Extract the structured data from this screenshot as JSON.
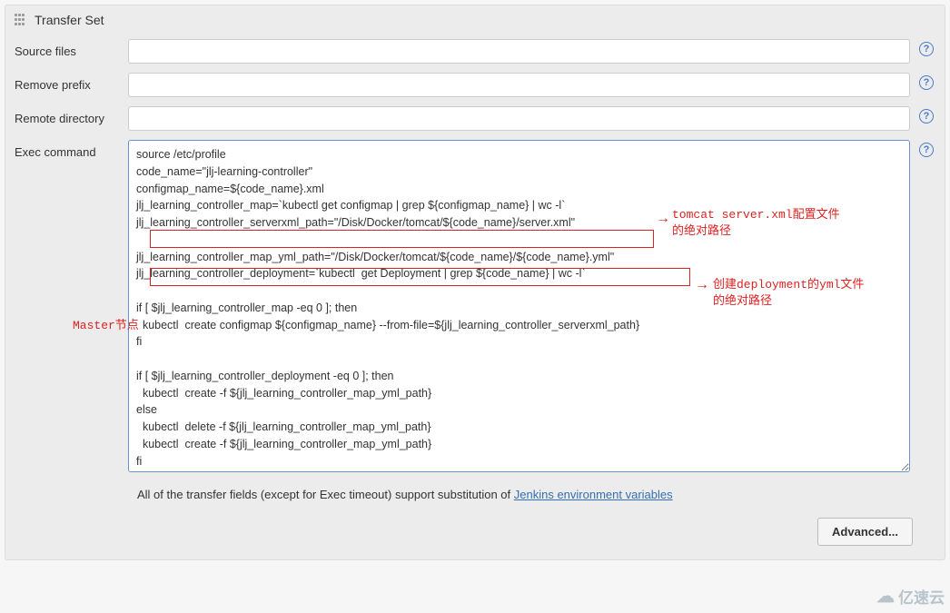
{
  "panelTitle": "Transfer Set",
  "labels": {
    "sourceFiles": "Source files",
    "removePrefix": "Remove prefix",
    "remoteDirectory": "Remote directory",
    "execCommand": "Exec command"
  },
  "values": {
    "sourceFiles": "",
    "removePrefix": "",
    "remoteDirectory": "",
    "execCommand": "source /etc/profile\ncode_name=\"jlj-learning-controller\"\nconfigmap_name=${code_name}.xml\njlj_learning_controller_map=`kubectl get configmap | grep ${configmap_name} | wc -l`\njlj_learning_controller_serverxml_path=\"/Disk/Docker/tomcat/${code_name}/server.xml\"\n\njlj_learning_controller_map_yml_path=\"/Disk/Docker/tomcat/${code_name}/${code_name}.yml\"\njlj_learning_controller_deployment=`kubectl  get Deployment | grep ${code_name} | wc -l`\n\nif [ $jlj_learning_controller_map -eq 0 ]; then\n  kubectl  create configmap ${configmap_name} --from-file=${jlj_learning_controller_serverxml_path}\nfi\n\nif [ $jlj_learning_controller_deployment -eq 0 ]; then\n  kubectl  create -f ${jlj_learning_controller_map_yml_path}\nelse\n  kubectl  delete -f ${jlj_learning_controller_map_yml_path}\n  kubectl  create -f ${jlj_learning_controller_map_yml_path}\nfi"
  },
  "footer": {
    "textBefore": "All of the transfer fields (except for Exec timeout) support substitution of ",
    "linkText": "Jenkins environment variables"
  },
  "advancedButton": "Advanced...",
  "helpGlyph": "?",
  "annotations": {
    "masterNode": "Master节点",
    "tomcatLine1": "tomcat server.xml配置文件",
    "tomcatLine2": "的绝对路径",
    "ymlLine1": "创建deployment的yml文件",
    "ymlLine2": "的绝对路径"
  },
  "watermark": "亿速云"
}
